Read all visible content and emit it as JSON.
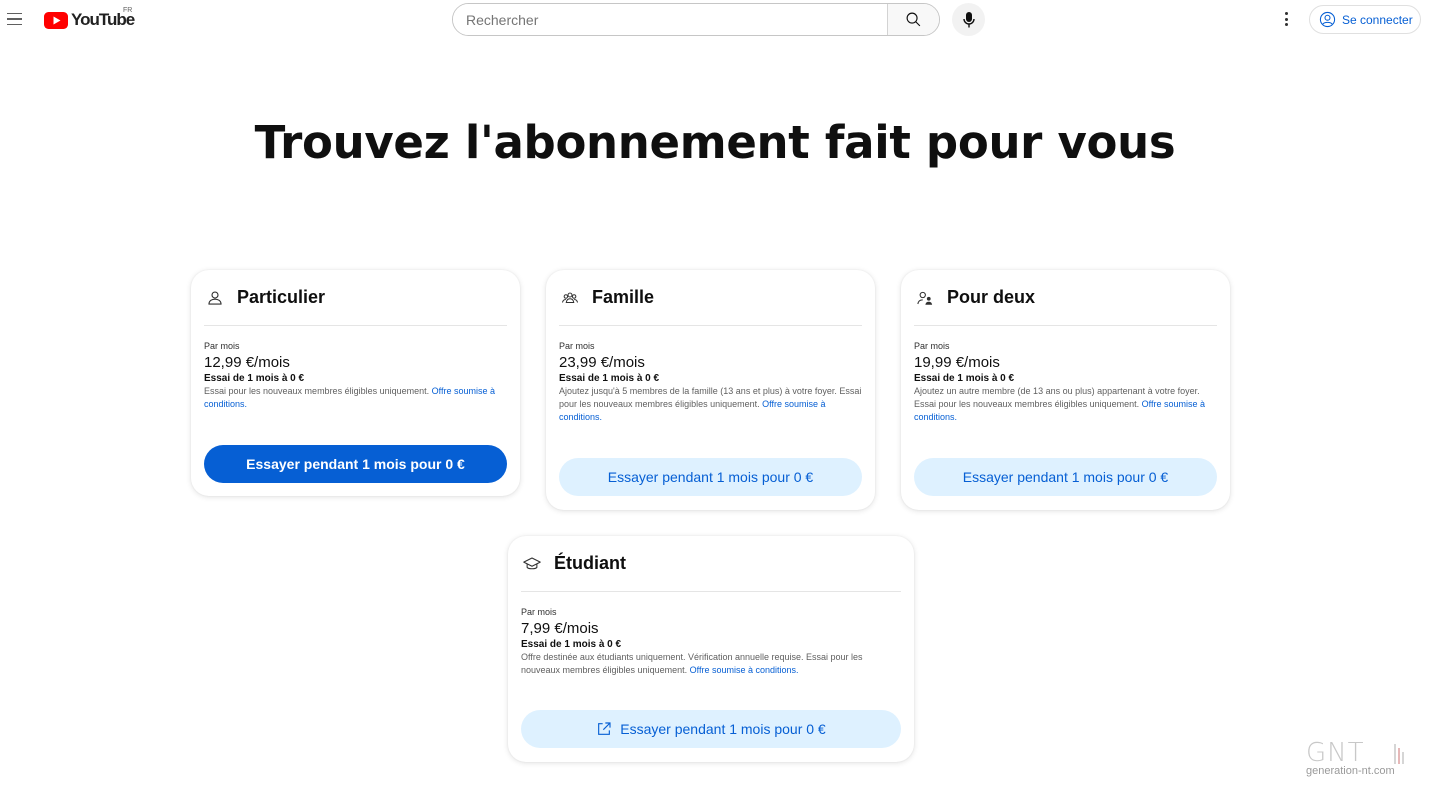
{
  "header": {
    "logo_text": "YouTube",
    "country_code": "FR",
    "search_placeholder": "Rechercher",
    "signin_label": "Se connecter"
  },
  "page_title": "Trouvez l'abonnement fait pour vous",
  "plans": [
    {
      "name": "Particulier",
      "icon": "person-icon",
      "per_month_label": "Par mois",
      "price": "12,99 €/mois",
      "trial": "Essai de 1 mois à 0 €",
      "desc": "Essai pour les nouveaux membres éligibles uniquement.",
      "link": "Offre soumise à conditions.",
      "cta": "Essayer pendant 1 mois pour 0 €"
    },
    {
      "name": "Famille",
      "icon": "family-icon",
      "per_month_label": "Par mois",
      "price": "23,99 €/mois",
      "trial": "Essai de 1 mois à 0 €",
      "desc": "Ajoutez jusqu'à 5 membres de la famille (13 ans et plus) à votre foyer. Essai pour les nouveaux membres éligibles uniquement.",
      "link": "Offre soumise à conditions.",
      "cta": "Essayer pendant 1 mois pour 0 €"
    },
    {
      "name": "Pour deux",
      "icon": "duo-icon",
      "per_month_label": "Par mois",
      "price": "19,99 €/mois",
      "trial": "Essai de 1 mois à 0 €",
      "desc": "Ajoutez un autre membre (de 13 ans ou plus) appartenant à votre foyer. Essai pour les nouveaux membres éligibles uniquement.",
      "link": "Offre soumise à conditions.",
      "cta": "Essayer pendant 1 mois pour 0 €"
    },
    {
      "name": "Étudiant",
      "icon": "graduation-cap-icon",
      "per_month_label": "Par mois",
      "price": "7,99 €/mois",
      "trial": "Essai de 1 mois à 0 €",
      "desc": "Offre destinée aux étudiants uniquement. Vérification annuelle requise. Essai pour les nouveaux membres éligibles uniquement.",
      "link": "Offre soumise à conditions.",
      "cta": "Essayer pendant 1 mois pour 0 €"
    }
  ],
  "watermark": {
    "logo": "GNT",
    "url": "generation-nt.com"
  },
  "colors": {
    "brand_red": "#ff0000",
    "link_blue": "#065fd4",
    "light_blue": "#def1ff"
  }
}
